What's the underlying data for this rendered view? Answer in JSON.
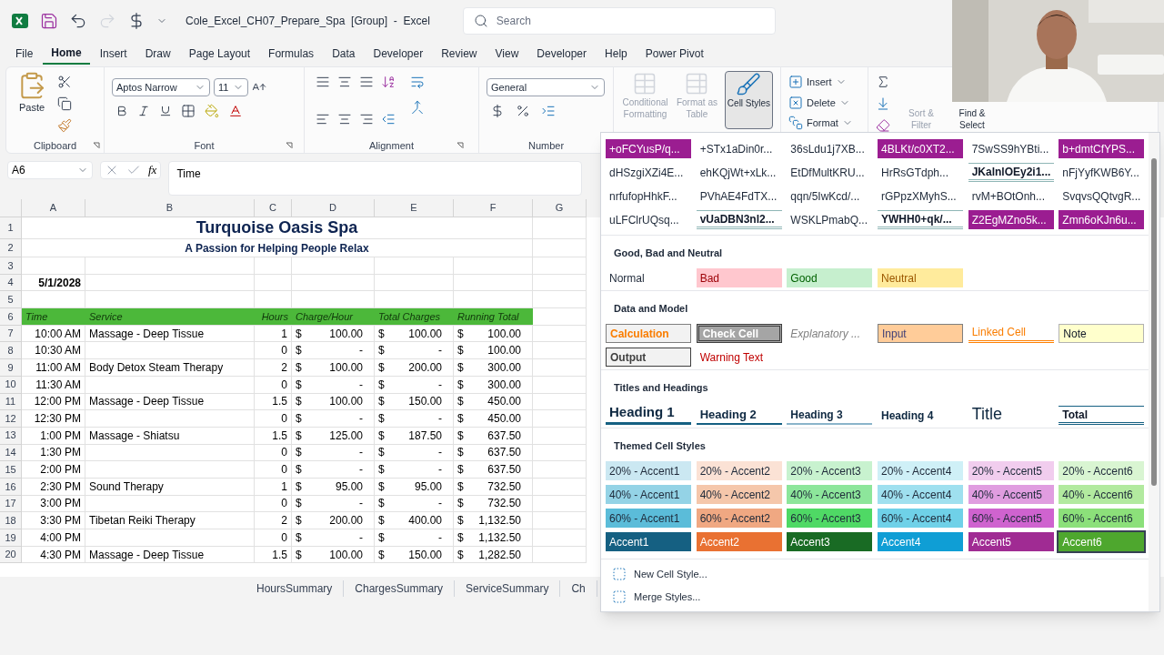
{
  "title_bar": {
    "document_title": "Cole_Excel_CH07_Prepare_Spa  [Group]  -  Excel",
    "search": {
      "placeholder": "Search"
    }
  },
  "menu_tabs": [
    {
      "label": "File",
      "selected": false
    },
    {
      "label": "Home",
      "selected": true
    },
    {
      "label": "Insert",
      "selected": false
    },
    {
      "label": "Draw",
      "selected": false
    },
    {
      "label": "Page Layout",
      "selected": false
    },
    {
      "label": "Formulas",
      "selected": false
    },
    {
      "label": "Data",
      "selected": false
    },
    {
      "label": "Developer",
      "selected": false
    },
    {
      "label": "Review",
      "selected": false
    },
    {
      "label": "View",
      "selected": false
    },
    {
      "label": "Developer",
      "selected": false
    },
    {
      "label": "Help",
      "selected": false
    },
    {
      "label": "Power Pivot",
      "selected": false
    }
  ],
  "ribbon": {
    "clipboard": {
      "paste": "Paste",
      "label": "Clipboard"
    },
    "font": {
      "name": "Aptos Narrow",
      "size": "11",
      "label": "Font"
    },
    "alignment": {
      "label": "Alignment"
    },
    "number": {
      "format": "General",
      "label": "Number"
    },
    "styles": [
      {
        "label": "Conditional Formatting",
        "disabled": true,
        "selected": false
      },
      {
        "label": "Format as Table",
        "disabled": true,
        "selected": false
      },
      {
        "label": "Cell Styles",
        "disabled": false,
        "selected": true
      }
    ],
    "cells": [
      "Insert",
      "Delete",
      "Format"
    ],
    "editing": [
      {
        "label": "Sort & Filter",
        "disabled": true
      },
      {
        "label": "Find & Select",
        "disabled": false
      }
    ]
  },
  "formula_bar": {
    "name_box": "A6",
    "function_button": "fx",
    "formula": "Time"
  },
  "sheet": {
    "columns": [
      "A",
      "B",
      "C",
      "D",
      "E",
      "F",
      "G"
    ],
    "top_row_numbers": [
      "1",
      "2",
      "3",
      "4",
      "5",
      "6"
    ],
    "title": "Turquoise Oasis Spa",
    "subtitle": "A Passion for Helping People Relax",
    "date": "5/1/2028",
    "headers": [
      "Time",
      "Service",
      "Hours",
      "Charge/Hour",
      "Total Charges",
      "Running Total"
    ],
    "rows": [
      {
        "number": "7",
        "cells": [
          "10:00 AM",
          "Massage - Deep Tissue",
          "1",
          {
            "symbol": "$",
            "amount": "100.00"
          },
          {
            "symbol": "$",
            "amount": "100.00"
          },
          {
            "symbol": "$",
            "amount": "100.00"
          }
        ]
      },
      {
        "number": "8",
        "cells": [
          "10:30 AM",
          "",
          "0",
          {
            "symbol": "$",
            "amount": "-"
          },
          {
            "symbol": "$",
            "amount": "-"
          },
          {
            "symbol": "$",
            "amount": "100.00"
          }
        ]
      },
      {
        "number": "9",
        "cells": [
          "11:00 AM",
          "Body Detox Steam Therapy",
          "2",
          {
            "symbol": "$",
            "amount": "100.00"
          },
          {
            "symbol": "$",
            "amount": "200.00"
          },
          {
            "symbol": "$",
            "amount": "300.00"
          }
        ]
      },
      {
        "number": "10",
        "cells": [
          "11:30 AM",
          "",
          "0",
          {
            "symbol": "$",
            "amount": "-"
          },
          {
            "symbol": "$",
            "amount": "-"
          },
          {
            "symbol": "$",
            "amount": "300.00"
          }
        ]
      },
      {
        "number": "11",
        "cells": [
          "12:00 PM",
          "Massage - Deep Tissue",
          "1.5",
          {
            "symbol": "$",
            "amount": "100.00"
          },
          {
            "symbol": "$",
            "amount": "150.00"
          },
          {
            "symbol": "$",
            "amount": "450.00"
          }
        ]
      },
      {
        "number": "12",
        "cells": [
          "12:30 PM",
          "",
          "0",
          {
            "symbol": "$",
            "amount": "-"
          },
          {
            "symbol": "$",
            "amount": "-"
          },
          {
            "symbol": "$",
            "amount": "450.00"
          }
        ]
      },
      {
        "number": "13",
        "cells": [
          "1:00 PM",
          "Massage - Shiatsu",
          "1.5",
          {
            "symbol": "$",
            "amount": "125.00"
          },
          {
            "symbol": "$",
            "amount": "187.50"
          },
          {
            "symbol": "$",
            "amount": "637.50"
          }
        ]
      },
      {
        "number": "14",
        "cells": [
          "1:30 PM",
          "",
          "0",
          {
            "symbol": "$",
            "amount": "-"
          },
          {
            "symbol": "$",
            "amount": "-"
          },
          {
            "symbol": "$",
            "amount": "637.50"
          }
        ]
      },
      {
        "number": "15",
        "cells": [
          "2:00 PM",
          "",
          "0",
          {
            "symbol": "$",
            "amount": "-"
          },
          {
            "symbol": "$",
            "amount": "-"
          },
          {
            "symbol": "$",
            "amount": "637.50"
          }
        ]
      },
      {
        "number": "16",
        "cells": [
          "2:30 PM",
          "Sound Therapy",
          "1",
          {
            "symbol": "$",
            "amount": "95.00"
          },
          {
            "symbol": "$",
            "amount": "95.00"
          },
          {
            "symbol": "$",
            "amount": "732.50"
          }
        ]
      },
      {
        "number": "17",
        "cells": [
          "3:00 PM",
          "",
          "0",
          {
            "symbol": "$",
            "amount": "-"
          },
          {
            "symbol": "$",
            "amount": "-"
          },
          {
            "symbol": "$",
            "amount": "732.50"
          }
        ]
      },
      {
        "number": "18",
        "cells": [
          "3:30 PM",
          "Tibetan Reiki Therapy",
          "2",
          {
            "symbol": "$",
            "amount": "200.00"
          },
          {
            "symbol": "$",
            "amount": "400.00"
          },
          {
            "symbol": "$",
            "amount": "1,132.50"
          }
        ]
      },
      {
        "number": "19",
        "cells": [
          "4:00 PM",
          "",
          "0",
          {
            "symbol": "$",
            "amount": "-"
          },
          {
            "symbol": "$",
            "amount": "-"
          },
          {
            "symbol": "$",
            "amount": "1,132.50"
          }
        ]
      },
      {
        "number": "20",
        "cells": [
          "4:30 PM",
          "Massage - Deep Tissue",
          "1.5",
          {
            "symbol": "$",
            "amount": "100.00"
          },
          {
            "symbol": "$",
            "amount": "150.00"
          },
          {
            "symbol": "$",
            "amount": "1,282.50"
          }
        ]
      }
    ]
  },
  "sheet_tabs": [
    "HoursSummary",
    "ChargesSummary",
    "ServiceSummary",
    "Ch"
  ],
  "cell_styles_gallery": {
    "custom": [
      [
        {
          "label": "+oFCYusP/q...",
          "kind": "fill"
        },
        {
          "label": "+STx1aDin0r...",
          "kind": "plain"
        },
        {
          "label": "36sLdu1j7XB...",
          "kind": "plain"
        },
        {
          "label": "4BLKt/c0XT2...",
          "kind": "fill"
        },
        {
          "label": "7SwSS9hYBti...",
          "kind": "plain"
        },
        {
          "label": "b+dmtCfYPS...",
          "kind": "fill"
        }
      ],
      [
        {
          "label": "dHSzgiXZi4E...",
          "kind": "plain"
        },
        {
          "label": "ehKQjWt+xLk...",
          "kind": "plain"
        },
        {
          "label": "EtDfMultKRU...",
          "kind": "plain"
        },
        {
          "label": "HrRsGTdph...",
          "kind": "plain"
        },
        {
          "label": "JKalnlOEy2i1...",
          "kind": "heading"
        },
        {
          "label": "nFjYyfKWB6Y...",
          "kind": "plain"
        }
      ],
      [
        {
          "label": "nrfufopHhkF...",
          "kind": "plain"
        },
        {
          "label": "PVhAE4FdTX...",
          "kind": "plain"
        },
        {
          "label": "qqn/5IwKcd/...",
          "kind": "plain"
        },
        {
          "label": "rGPpzXMyhS...",
          "kind": "plain"
        },
        {
          "label": "rvM+BOtOnh...",
          "kind": "plain"
        },
        {
          "label": "SvqvsQQtvgR...",
          "kind": "plain"
        }
      ],
      [
        {
          "label": "uLFClrUQsq...",
          "kind": "plain"
        },
        {
          "label": "vUaDBN3nl2...",
          "kind": "heading"
        },
        {
          "label": "WSKLPmabQ...",
          "kind": "plain"
        },
        {
          "label": "YWHH0+qk/...",
          "kind": "heading"
        },
        {
          "label": "Z2EgMZno5k...",
          "kind": "fill"
        },
        {
          "label": "Zmn6oKJn6u...",
          "kind": "fill"
        }
      ]
    ],
    "sections": [
      {
        "title": "Good, Bad and Neutral",
        "items": [
          {
            "label": "Normal",
            "kind": "normal"
          },
          {
            "label": "Bad",
            "kind": "bad"
          },
          {
            "label": "Good",
            "kind": "good"
          },
          {
            "label": "Neutral",
            "kind": "neutral"
          }
        ]
      },
      {
        "title": "Data and Model",
        "items": [
          {
            "label": "Calculation",
            "kind": "calculation"
          },
          {
            "label": "Check Cell",
            "kind": "check"
          },
          {
            "label": "Explanatory ...",
            "kind": "explanatory"
          },
          {
            "label": "Input",
            "kind": "input"
          },
          {
            "label": "Linked Cell",
            "kind": "linked"
          },
          {
            "label": "Note",
            "kind": "note"
          },
          {
            "label": "Output",
            "kind": "output"
          },
          {
            "label": "Warning Text",
            "kind": "warning"
          }
        ]
      },
      {
        "title": "Titles and Headings",
        "items": [
          {
            "label": "Heading 1",
            "kind": "heading1"
          },
          {
            "label": "Heading 2",
            "kind": "heading2"
          },
          {
            "label": "Heading 3",
            "kind": "heading3"
          },
          {
            "label": "Heading 4",
            "kind": "heading4"
          },
          {
            "label": "Title",
            "kind": "title"
          },
          {
            "label": "Total",
            "kind": "total"
          }
        ]
      }
    ],
    "themed": {
      "title": "Themed Cell Styles",
      "rows": [
        [
          {
            "label": "20% - Accent1",
            "color": "#cbe8f2",
            "kind": "light",
            "selected": false
          },
          {
            "label": "20% - Accent2",
            "color": "#fbe2d5",
            "kind": "light",
            "selected": false
          },
          {
            "label": "20% - Accent3",
            "color": "#c8f2cf",
            "kind": "light",
            "selected": false
          },
          {
            "label": "20% - Accent4",
            "color": "#cff0f7",
            "kind": "light",
            "selected": false
          },
          {
            "label": "20% - Accent5",
            "color": "#f1cdee",
            "kind": "light",
            "selected": false
          },
          {
            "label": "20% - Accent6",
            "color": "#d9f5d2",
            "kind": "light",
            "selected": false
          }
        ],
        [
          {
            "label": "40% - Accent1",
            "color": "#94d3e6",
            "kind": "light",
            "selected": false
          },
          {
            "label": "40% - Accent2",
            "color": "#f5c7ab",
            "kind": "light",
            "selected": false
          },
          {
            "label": "40% - Accent3",
            "color": "#8de69b",
            "kind": "light",
            "selected": false
          },
          {
            "label": "40% - Accent4",
            "color": "#9fe0ef",
            "kind": "light",
            "selected": false
          },
          {
            "label": "40% - Accent5",
            "color": "#e09de0",
            "kind": "light",
            "selected": false
          },
          {
            "label": "40% - Accent6",
            "color": "#b2ea9f",
            "kind": "light",
            "selected": false
          }
        ],
        [
          {
            "label": "60% - Accent1",
            "color": "#5bbcd9",
            "kind": "light",
            "selected": false
          },
          {
            "label": "60% - Accent2",
            "color": "#f0a882",
            "kind": "light",
            "selected": false
          },
          {
            "label": "60% - Accent3",
            "color": "#4fd965",
            "kind": "light",
            "selected": false
          },
          {
            "label": "60% - Accent4",
            "color": "#6fd1e8",
            "kind": "light",
            "selected": false
          },
          {
            "label": "60% - Accent5",
            "color": "#cf63cf",
            "kind": "light",
            "selected": false
          },
          {
            "label": "60% - Accent6",
            "color": "#8ce07a",
            "kind": "light",
            "selected": false
          }
        ],
        [
          {
            "label": "Accent1",
            "color": "#156082",
            "kind": "dark",
            "selected": false
          },
          {
            "label": "Accent2",
            "color": "#e97132",
            "kind": "dark",
            "selected": false
          },
          {
            "label": "Accent3",
            "color": "#196b24",
            "kind": "dark",
            "selected": false
          },
          {
            "label": "Accent4",
            "color": "#0f9ed5",
            "kind": "dark",
            "selected": false
          },
          {
            "label": "Accent5",
            "color": "#a02b93",
            "kind": "dark",
            "selected": false
          },
          {
            "label": "Accent6",
            "color": "#4ea72e",
            "kind": "dark",
            "selected": true
          }
        ]
      ]
    },
    "actions": [
      "New Cell Style...",
      "Merge Styles..."
    ]
  }
}
